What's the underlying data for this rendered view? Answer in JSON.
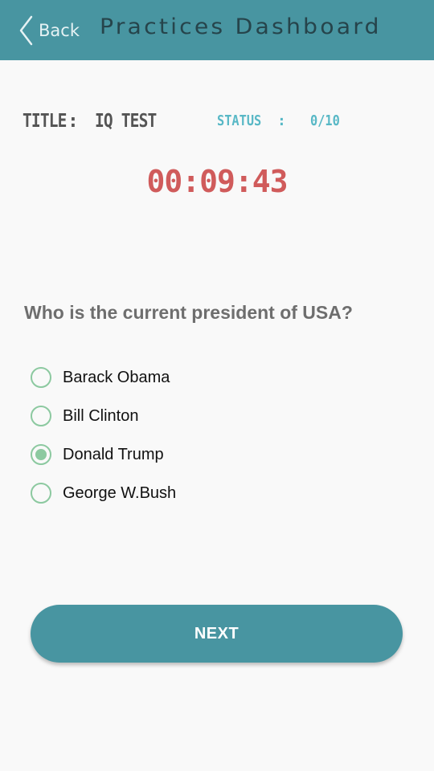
{
  "header": {
    "back_label": "Back",
    "title": "Practices Dashboard"
  },
  "info": {
    "title_key": "TITLE",
    "title_sep": ":",
    "title_value": "IQ TEST",
    "status_key": "STATUS",
    "status_sep": ":",
    "status_value": "0/10"
  },
  "timer": "00:09:43",
  "question": "Who is the current president of USA?",
  "options": [
    {
      "label": "Barack Obama",
      "selected": false
    },
    {
      "label": "Bill Clinton",
      "selected": false
    },
    {
      "label": "Donald Trump",
      "selected": true
    },
    {
      "label": "George W.Bush",
      "selected": false
    }
  ],
  "next_label": "NEXT",
  "colors": {
    "primary": "#4895a1",
    "timer": "#d05b5b",
    "status": "#58b8c6",
    "radio": "#8cc9a0"
  },
  "icons": {
    "back": "chevron-left-icon"
  }
}
